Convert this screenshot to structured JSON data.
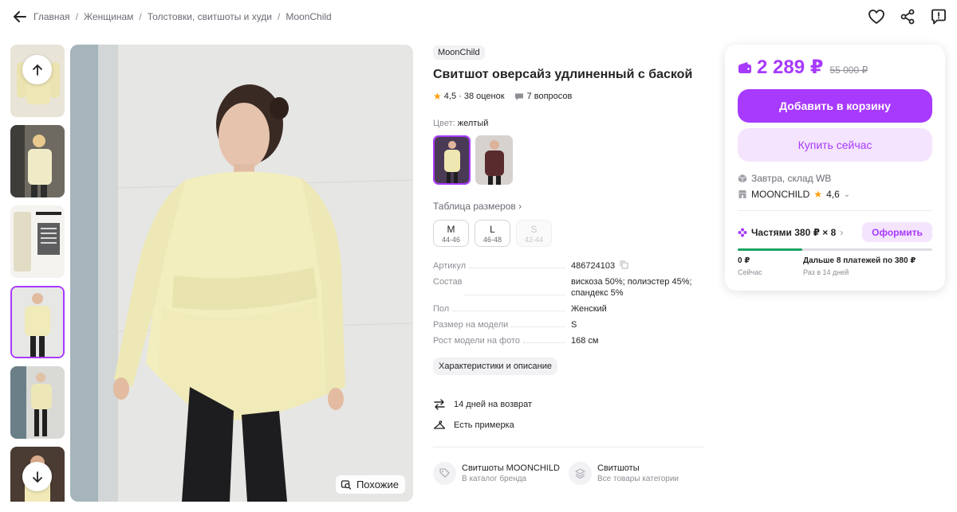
{
  "breadcrumbs": [
    "Главная",
    "Женщинам",
    "Толстовки, свитшоты и худи",
    "MoonChild"
  ],
  "top_actions": [
    "heart-icon",
    "share-icon",
    "report-icon"
  ],
  "gallery": {
    "thumb_count": 6,
    "selected_index": 3,
    "similar_label": "Похожие"
  },
  "product": {
    "brand": "MoonChild",
    "title": "Свитшот оверсайз удлиненный с баской",
    "rating": "4,5",
    "reviews": "· 38 оценок",
    "questions": "7 вопросов",
    "color_label": "Цвет:",
    "color_value": "желтый",
    "size_table_label": "Таблица размеров",
    "sizes": [
      {
        "size": "M",
        "ru": "44-46",
        "available": true
      },
      {
        "size": "L",
        "ru": "46-48",
        "available": true
      },
      {
        "size": "S",
        "ru": "42-44",
        "available": false
      }
    ],
    "specs": [
      {
        "key": "Артикул",
        "value": "486724103"
      },
      {
        "key": "Состав",
        "value": "вискоза 50%; полиэстер 45%; спандекс 5%"
      },
      {
        "key": "Пол",
        "value": "Женский"
      },
      {
        "key": "Размер на модели",
        "value": "S"
      },
      {
        "key": "Рост модели на фото",
        "value": "168 см"
      }
    ],
    "characteristics_button": "Характеристики и описание",
    "features": [
      "14 дней на возврат",
      "Есть примерка"
    ],
    "links": [
      {
        "title": "Свитшоты MOONCHILD",
        "subtitle": "В каталог бренда"
      },
      {
        "title": "Свитшоты",
        "subtitle": "Все товары категории"
      }
    ]
  },
  "buy_card": {
    "price": "2 289 ₽",
    "old_price": "55 000 ₽",
    "add_to_cart": "Добавить в корзину",
    "buy_now": "Купить сейчас",
    "delivery": "Завтра, склад WB",
    "seller_name": "MOONCHILD",
    "seller_rating": "4,6",
    "installment": "Частями 380 ₽ × 8",
    "installment_button": "Оформить",
    "installment_progress": 0.33,
    "pay_now_amount": "0 ₽",
    "pay_now_label": "Сейчас",
    "pay_later_amount": "Дальше 8 платежей по 380 ₽",
    "pay_later_label": "Раз в 14 дней",
    "accent_color": "#a73afd"
  }
}
